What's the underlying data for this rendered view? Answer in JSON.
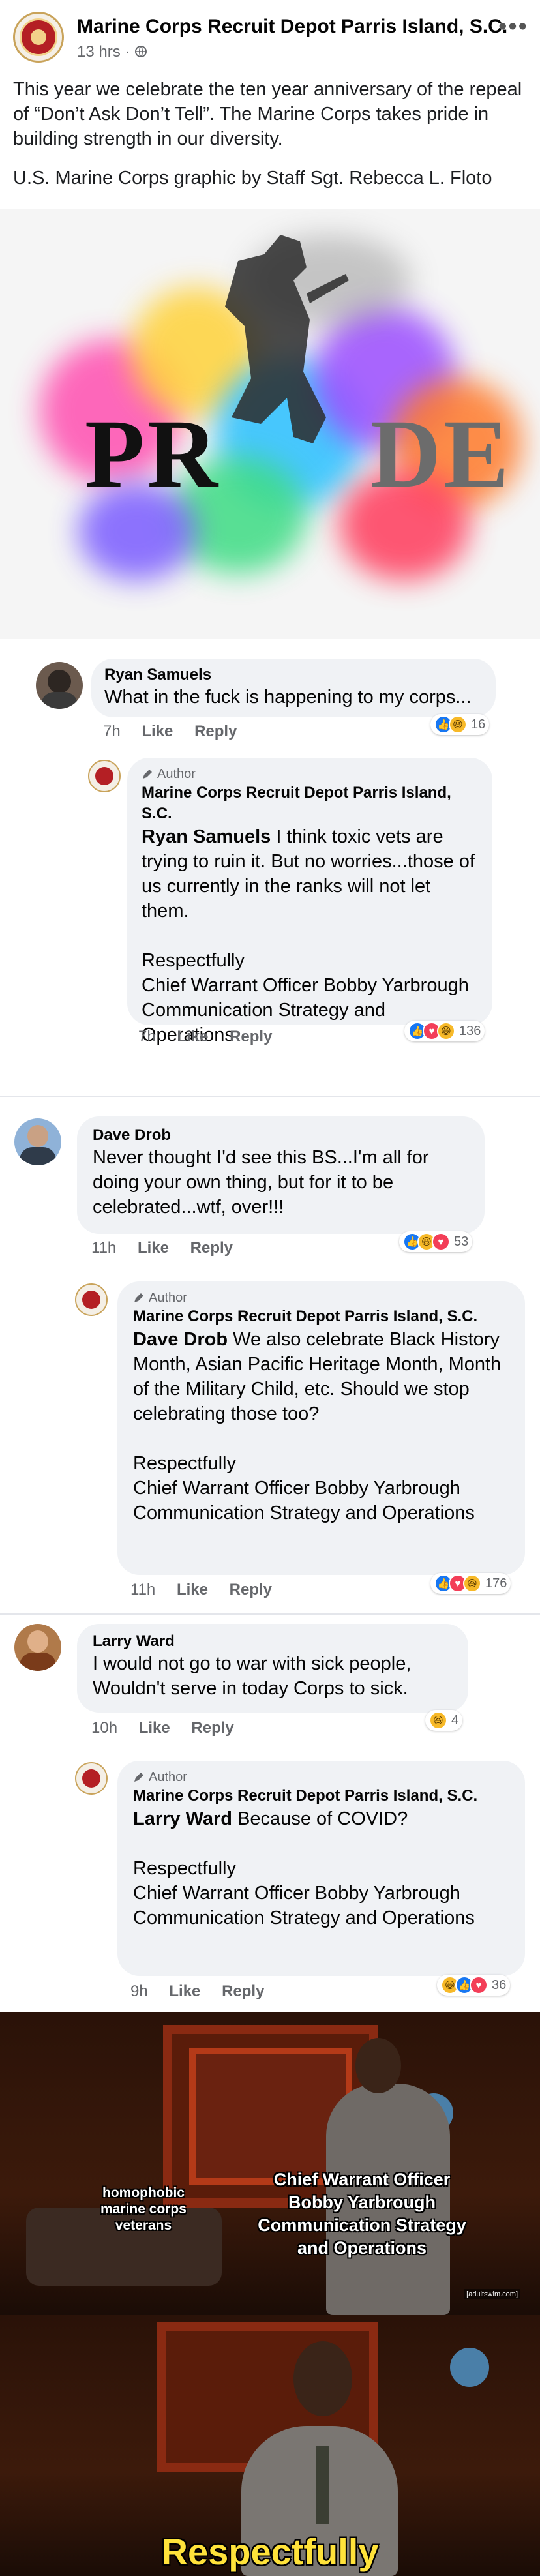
{
  "post": {
    "page_name": "Marine Corps Recruit Depot Parris Island, S.C.",
    "time": "13 hrs ·",
    "privacy_icon": "globe-icon",
    "body": "This year we celebrate the ten year anniversary of the repeal of “Don’t Ask Don’t Tell”. The Marine Corps takes pride in building strength in our diversity.",
    "credit": "U.S. Marine Corps graphic by Staff Sgt. Rebecca L. Floto",
    "graphic_word": "PR",
    "graphic_word_end": "DE"
  },
  "common": {
    "like": "Like",
    "reply": "Reply",
    "author": "Author",
    "page_name": "Marine Corps Recruit Depot Parris Island, S.C."
  },
  "comments": [
    {
      "name": "Ryan Samuels",
      "text": "What in the fuck is happening to my corps...",
      "time": "7h",
      "reaction_count": "16",
      "reactions": [
        "like",
        "haha"
      ],
      "reply": {
        "mention": "Ryan Samuels",
        "text": " I think toxic vets are trying to ruin it. But no worries...those of us currently in the ranks will not let them.",
        "signoff": "Respectfully\nChief Warrant Officer Bobby Yarbrough\nCommunication Strategy and Operations",
        "time": "7h",
        "reaction_count": "136",
        "reactions": [
          "like",
          "love",
          "haha"
        ]
      }
    },
    {
      "name": "Dave Drob",
      "text": "Never thought I'd see this BS...I'm all for doing your own thing, but for it to be celebrated...wtf, over!!!",
      "time": "11h",
      "reaction_count": "53",
      "reactions": [
        "like",
        "haha",
        "love"
      ],
      "reply": {
        "mention": "Dave Drob",
        "text": " We also celebrate Black History Month, Asian Pacific Heritage Month, Month of the Military Child, etc. Should we stop celebrating those too?",
        "signoff": "Respectfully\nChief Warrant Officer Bobby Yarbrough\nCommunication Strategy and Operations",
        "time": "11h",
        "reaction_count": "176",
        "reactions": [
          "like",
          "love",
          "haha"
        ]
      }
    },
    {
      "name": "Larry Ward",
      "text": "I would not go to war with sick people, Wouldn't serve in today Corps to sick.",
      "time": "10h",
      "reaction_count": "4",
      "reactions": [
        "haha"
      ],
      "reply": {
        "mention": "Larry Ward",
        "text": " Because of COVID?",
        "signoff": "Respectfully\nChief Warrant Officer Bobby Yarbrough\nCommunication Strategy and Operations",
        "time": "9h",
        "reaction_count": "36",
        "reactions": [
          "haha",
          "like",
          "love"
        ]
      }
    }
  ],
  "meme": {
    "left_label": "homophobic marine corps veterans",
    "right_label": "Chief Warrant Officer Bobby Yarbrough Communication Strategy and Operations",
    "watermark": "[adultswim.com]",
    "bottom_caption": "Respectfully"
  }
}
